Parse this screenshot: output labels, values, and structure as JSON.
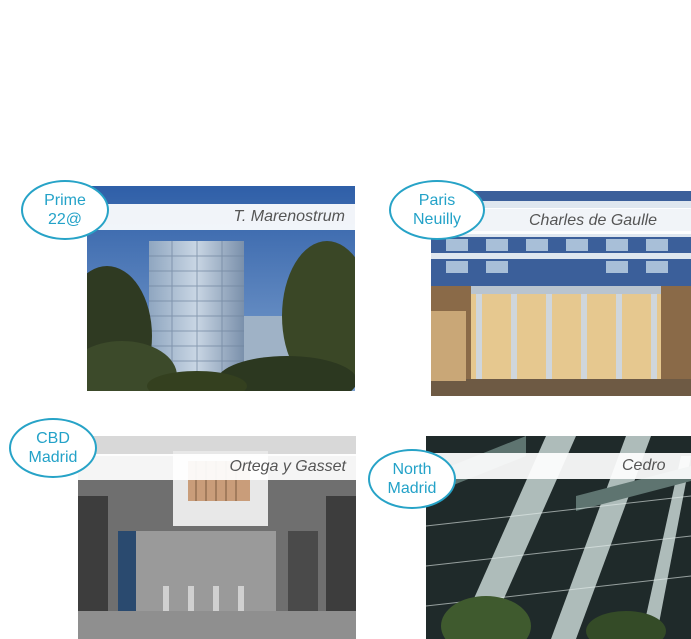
{
  "slides": [
    {
      "district_line1": "Prime",
      "district_line2": "22@",
      "building": "T. Marenostrum"
    },
    {
      "district_line1": "Paris",
      "district_line2": "Neuilly",
      "building": "Charles de Gaulle"
    },
    {
      "district_line1": "CBD",
      "district_line2": "Madrid",
      "building": "Ortega y Gasset"
    },
    {
      "district_line1": "North",
      "district_line2": "Madrid",
      "building": "Cedro"
    }
  ],
  "colors": {
    "bubble_border": "#27a3c7",
    "bubble_text": "#23a2c8",
    "caption_text": "#555555"
  },
  "icons": [
    "building-photo"
  ]
}
